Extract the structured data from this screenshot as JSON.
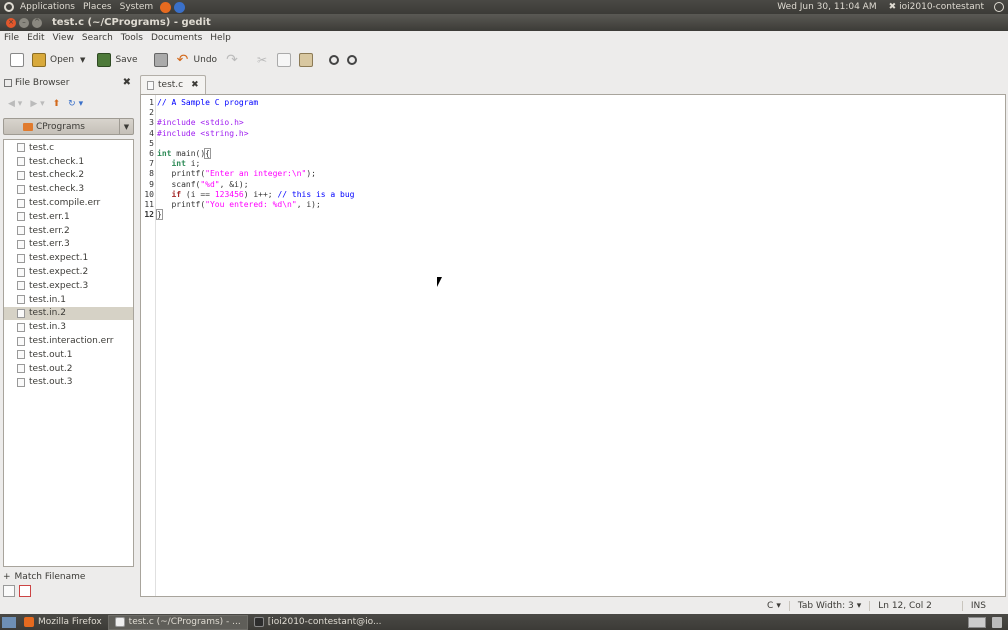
{
  "top_panel": {
    "menus": [
      "Applications",
      "Places",
      "System"
    ],
    "clock": "Wed Jun 30, 11:04 AM",
    "user": "ioi2010-contestant"
  },
  "window": {
    "title": "test.c (~/CPrograms) - gedit"
  },
  "menubar": [
    "File",
    "Edit",
    "View",
    "Search",
    "Tools",
    "Documents",
    "Help"
  ],
  "toolbar": {
    "open_label": "Open",
    "save_label": "Save",
    "undo_label": "Undo"
  },
  "side_panel": {
    "title": "File Browser",
    "folder": "CPrograms",
    "files": [
      "test.c",
      "test.check.1",
      "test.check.2",
      "test.check.3",
      "test.compile.err",
      "test.err.1",
      "test.err.2",
      "test.err.3",
      "test.expect.1",
      "test.expect.2",
      "test.expect.3",
      "test.in.1",
      "test.in.2",
      "test.in.3",
      "test.interaction.err",
      "test.out.1",
      "test.out.2",
      "test.out.3"
    ],
    "selected_file": "test.in.2",
    "match_filename": "Match Filename"
  },
  "tab": {
    "label": "test.c"
  },
  "editor": {
    "line_numbers": [
      "1",
      "2",
      "3",
      "4",
      "5",
      "6",
      "7",
      "8",
      "9",
      "10",
      "11",
      "12"
    ],
    "current_line": 12,
    "lines": [
      [
        {
          "t": "comment",
          "v": "// A Sample C program"
        }
      ],
      [],
      [
        {
          "t": "preproc",
          "v": "#include <stdio.h>"
        }
      ],
      [
        {
          "t": "preproc",
          "v": "#include <string.h>"
        }
      ],
      [],
      [
        {
          "t": "type",
          "v": "int"
        },
        {
          "t": "plain",
          "v": " main()"
        },
        {
          "t": "bracket",
          "v": "{"
        }
      ],
      [
        {
          "t": "plain",
          "v": "   "
        },
        {
          "t": "type",
          "v": "int"
        },
        {
          "t": "plain",
          "v": " i;"
        }
      ],
      [
        {
          "t": "plain",
          "v": "   printf("
        },
        {
          "t": "string",
          "v": "\"Enter an integer:\\n\""
        },
        {
          "t": "plain",
          "v": ");"
        }
      ],
      [
        {
          "t": "plain",
          "v": "   scanf("
        },
        {
          "t": "string",
          "v": "\"%d\""
        },
        {
          "t": "plain",
          "v": ", &i);"
        }
      ],
      [
        {
          "t": "plain",
          "v": "   "
        },
        {
          "t": "keyword",
          "v": "if"
        },
        {
          "t": "plain",
          "v": " (i == "
        },
        {
          "t": "number",
          "v": "123456"
        },
        {
          "t": "plain",
          "v": ") i++; "
        },
        {
          "t": "comment",
          "v": "// this is a bug"
        }
      ],
      [
        {
          "t": "plain",
          "v": "   printf("
        },
        {
          "t": "string",
          "v": "\"You entered: %d\\n\""
        },
        {
          "t": "plain",
          "v": ", i);"
        }
      ],
      [
        {
          "t": "bracket",
          "v": "}"
        },
        {
          "t": "caret",
          "v": ""
        }
      ]
    ]
  },
  "statusbar": {
    "language": "C",
    "tab_width": "Tab Width:  3",
    "position": "Ln 12, Col 2",
    "mode": "INS"
  },
  "taskbar": {
    "tasks": [
      "Mozilla Firefox",
      "test.c (~/CPrograms) - ...",
      "[ioi2010-contestant@io..."
    ]
  }
}
